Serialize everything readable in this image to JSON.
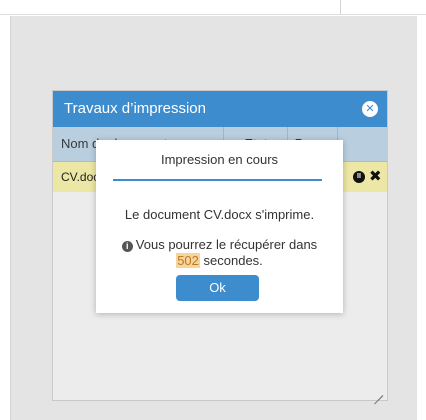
{
  "window": {
    "title": "Travaux d’impression",
    "close_icon": "close-circle-icon"
  },
  "table": {
    "columns": [
      "Nom du document",
      "Etat",
      "Pages",
      ""
    ],
    "rows": [
      {
        "name": "CV.docx",
        "actions": [
          "pause-icon",
          "close-icon"
        ]
      }
    ]
  },
  "modal": {
    "title": "Impression en cours",
    "message": "Le document CV.docx s'imprime.",
    "info_prefix": "Vous pourrez le récupérer dans",
    "seconds": "502",
    "info_suffix": "secondes.",
    "ok_label": "Ok"
  },
  "colors": {
    "accent": "#3d8cce",
    "row_highlight": "#ece7a4",
    "seconds_highlight": "#f6d4a0"
  }
}
